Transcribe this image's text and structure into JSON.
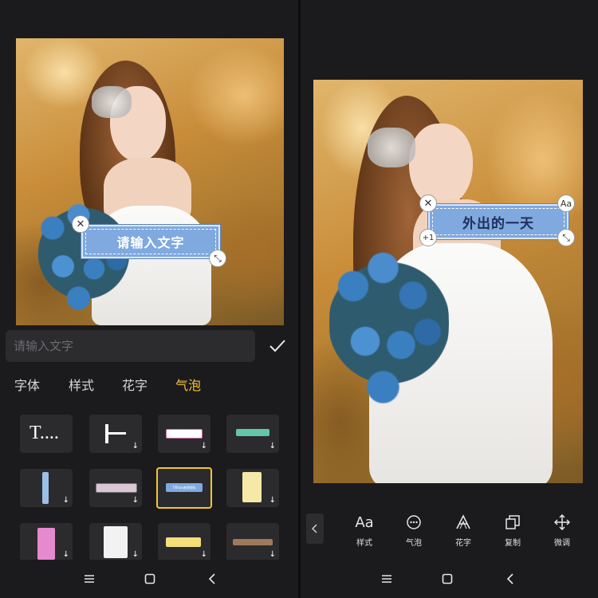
{
  "left_screen": {
    "sticker_text": "请输入文字",
    "input_placeholder": "请输入文字",
    "tabs": [
      "字体",
      "样式",
      "花字",
      "气泡"
    ],
    "active_tab": "气泡",
    "accent_color": "#f5c33b",
    "grid_icons": [
      "text-dots-preview",
      "text-cursor-preview",
      "bubble-thumbnail"
    ],
    "grid_thumbnail_text": "Tifikon者视频标"
  },
  "right_screen": {
    "sticker_text": "外出的一天",
    "font_handle_label": "Aa",
    "plus_one_label": "+1",
    "toolbar": [
      {
        "icon": "font-aa-icon",
        "label": "样式"
      },
      {
        "icon": "speech-bubble-icon",
        "label": "气泡"
      },
      {
        "icon": "fancy-a-icon",
        "label": "花字"
      },
      {
        "icon": "copy-icon",
        "label": "复制"
      },
      {
        "icon": "move-arrows-icon",
        "label": "微调"
      }
    ]
  },
  "navbar": {
    "icons": [
      "menu-icon",
      "home-square-icon",
      "back-chevron-icon"
    ]
  },
  "colors": {
    "bubble_fill": "#7fa9df",
    "selected_border": "#f3c634",
    "panel_bg": "#1b1b1d"
  }
}
